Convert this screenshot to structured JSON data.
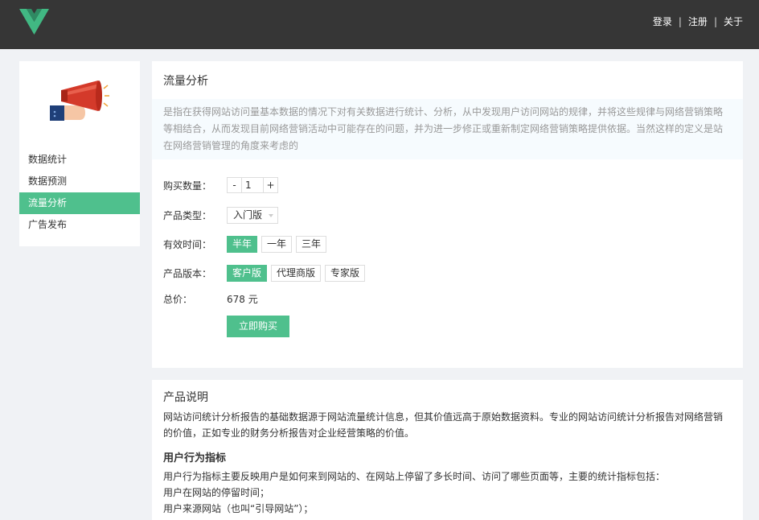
{
  "header": {
    "logo_icon": "vue-logo-icon",
    "nav": {
      "login": "登录",
      "register": "注册",
      "about": "关于",
      "separator": "|"
    }
  },
  "sidebar": {
    "illustration_icon": "megaphone-icon",
    "items": [
      {
        "label": "数据统计",
        "active": false
      },
      {
        "label": "数据预测",
        "active": false
      },
      {
        "label": "流量分析",
        "active": true
      },
      {
        "label": "广告发布",
        "active": false
      }
    ]
  },
  "main": {
    "title": "流量分析",
    "intro": "是指在获得网站访问量基本数据的情况下对有关数据进行统计、分析，从中发现用户访问网站的规律，并将这些规律与网络营销策略等相结合，从而发现目前网络营销活动中可能存在的问题，并为进一步修正或重新制定网络营销策略提供依据。当然这样的定义是站在网络营销管理的角度来考虑的",
    "quantity": {
      "label": "购买数量：",
      "minus": "-",
      "value": "1",
      "plus": "+"
    },
    "product_type": {
      "label": "产品类型：",
      "selected": "入门版"
    },
    "duration": {
      "label": "有效时间：",
      "options": [
        "半年",
        "一年",
        "三年"
      ],
      "selected": "半年"
    },
    "edition": {
      "label": "产品版本：",
      "options": [
        "客户版",
        "代理商版",
        "专家版"
      ],
      "selected": "客户版"
    },
    "total": {
      "label": "总价：",
      "value": "678 元"
    },
    "buy_label": "立即购买"
  },
  "description": {
    "title": "产品说明",
    "body": "网站访问统计分析报告的基础数据源于网站流量统计信息，但其价值远高于原始数据资料。专业的网站访问统计分析报告对网络营销的价值，正如专业的财务分析报告对企业经营策略的价值。",
    "subtitle": "用户行为指标",
    "lines": [
      "用户行为指标主要反映用户是如何来到网站的、在网站上停留了多长时间、访问了哪些页面等，主要的统计指标包括：",
      "用户在网站的停留时间；",
      "用户来源网站（也叫“引导网站”）；"
    ]
  },
  "colors": {
    "accent": "#4fc08d",
    "header_bg": "#363636",
    "page_bg": "#f0f2f5"
  }
}
